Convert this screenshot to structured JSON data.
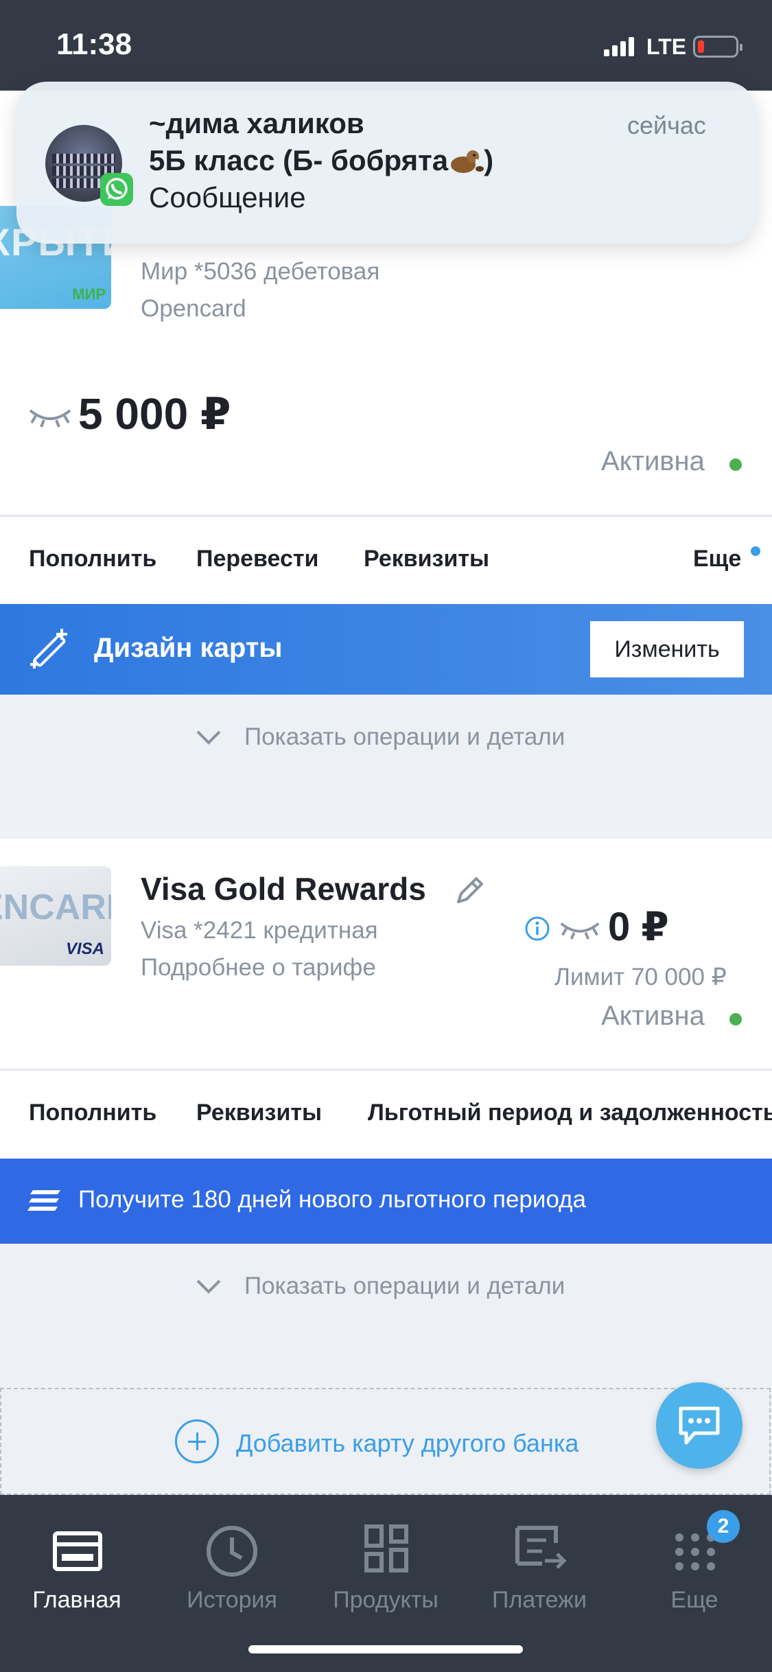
{
  "status_bar": {
    "time": "11:38",
    "network": "LTE"
  },
  "notification": {
    "sender": "~дима халиков",
    "group": "5Б класс (Б- бобрята",
    "group_suffix": ")",
    "message": "Сообщение",
    "time": "сейчас",
    "app_icon": "whatsapp-icon"
  },
  "card1": {
    "logo_text": "КРЫТИЕ",
    "system": "МИР",
    "subtitle": "Мир *5036 дебетовая",
    "product": "Opencard",
    "balance": "5 000 ₽",
    "status": "Активна",
    "actions": [
      "Пополнить",
      "Перевести",
      "Реквизиты"
    ],
    "more": "Еще"
  },
  "design_bar": {
    "title": "Дизайн карты",
    "button": "Изменить"
  },
  "show_ops_label": "Показать операции и детали",
  "card2": {
    "logo_text": "ENCARD",
    "system": "VISA",
    "title": "Visa Gold Rewards",
    "subtitle": "Visa *2421 кредитная",
    "tariff_link": "Подробнее о тарифе",
    "balance": "0 ₽",
    "limit": "Лимит 70 000 ₽",
    "status": "Активна",
    "actions": [
      "Пополнить",
      "Реквизиты",
      "Льготный период и задолженность"
    ]
  },
  "promo_bar": {
    "text": "Получите 180 дней нового льготного периода"
  },
  "add_bank": {
    "label": "Добавить карту другого банка"
  },
  "tabbar": {
    "items": [
      {
        "label": "Главная",
        "icon": "card-icon",
        "active": true
      },
      {
        "label": "История",
        "icon": "clock-icon",
        "active": false
      },
      {
        "label": "Продукты",
        "icon": "grid-icon",
        "active": false
      },
      {
        "label": "Платежи",
        "icon": "transfer-icon",
        "active": false
      },
      {
        "label": "Еще",
        "icon": "dots-icon",
        "active": false
      }
    ],
    "more_badge": "2"
  },
  "colors": {
    "accent": "#3a9ee8",
    "primary_blue": "#2f6ae4",
    "status_green": "#4caf50",
    "dark_bg": "#343a45"
  }
}
